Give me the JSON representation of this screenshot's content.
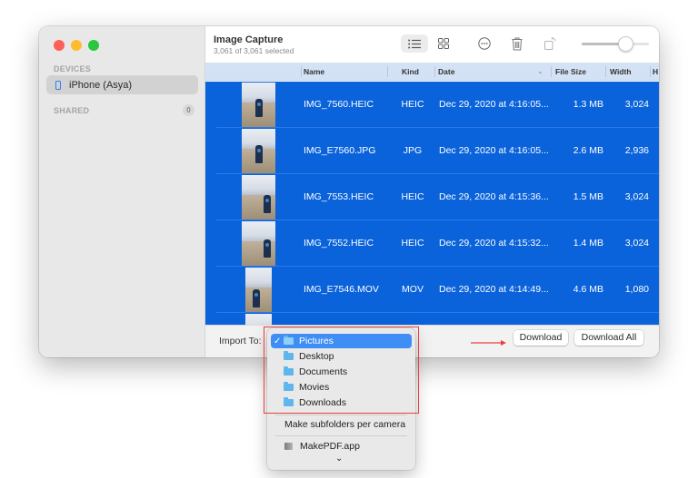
{
  "window": {
    "title": "Image Capture",
    "subtitle": "3,061 of 3,061 selected"
  },
  "sidebar": {
    "devices_heading": "DEVICES",
    "devices": [
      {
        "label": "iPhone (Asya)",
        "icon": "iphone-icon",
        "selected": true
      }
    ],
    "shared_heading": "SHARED",
    "shared_count": "0"
  },
  "toolbar": {
    "buttons": [
      {
        "name": "list-view",
        "icon": "list-icon",
        "active": true
      },
      {
        "name": "grid-view",
        "icon": "grid-icon",
        "active": false
      },
      {
        "name": "more",
        "icon": "ellipsis-circle-icon",
        "active": false
      },
      {
        "name": "delete",
        "icon": "trash-icon",
        "active": false
      },
      {
        "name": "rotate",
        "icon": "rotate-icon",
        "active": false
      }
    ],
    "thumbnail_size": 0.7
  },
  "table": {
    "columns": [
      "Name",
      "Kind",
      "Date",
      "File Size",
      "Width",
      "H"
    ],
    "sort_column": "Date",
    "rows": [
      {
        "name": "IMG_7560.HEIC",
        "kind": "HEIC",
        "date": "Dec 29, 2020 at 4:16:05...",
        "size": "1.3 MB",
        "width": "3,024"
      },
      {
        "name": "IMG_E7560.JPG",
        "kind": "JPG",
        "date": "Dec 29, 2020 at 4:16:05...",
        "size": "2.6 MB",
        "width": "2,936"
      },
      {
        "name": "IMG_7553.HEIC",
        "kind": "HEIC",
        "date": "Dec 29, 2020 at 4:15:36...",
        "size": "1.5 MB",
        "width": "3,024"
      },
      {
        "name": "IMG_7552.HEIC",
        "kind": "HEIC",
        "date": "Dec 29, 2020 at 4:15:32...",
        "size": "1.4 MB",
        "width": "3,024"
      },
      {
        "name": "IMG_E7546.MOV",
        "kind": "MOV",
        "date": "Dec 29, 2020 at 4:14:49...",
        "size": "4.6 MB",
        "width": "1,080"
      }
    ]
  },
  "bottom": {
    "import_label": "Import To:",
    "download_label": "Download",
    "download_all_label": "Download All"
  },
  "import_menu": {
    "selected": "Pictures",
    "folders": [
      {
        "label": "Pictures",
        "icon": "pictures-folder-icon",
        "checked": true
      },
      {
        "label": "Desktop",
        "icon": "desktop-folder-icon",
        "checked": false
      },
      {
        "label": "Documents",
        "icon": "documents-folder-icon",
        "checked": false
      },
      {
        "label": "Movies",
        "icon": "movies-folder-icon",
        "checked": false
      },
      {
        "label": "Downloads",
        "icon": "downloads-folder-icon",
        "checked": false
      }
    ],
    "check_glyph": "✓",
    "subfolders_label": "Make subfolders per camera",
    "app_label": "MakePDF.app",
    "more_glyph": "⌄"
  },
  "colors": {
    "selection": "#0b63db",
    "header": "#d4e2f6",
    "menu_highlight": "#3f8ef5",
    "annotation": "#e8413b"
  }
}
